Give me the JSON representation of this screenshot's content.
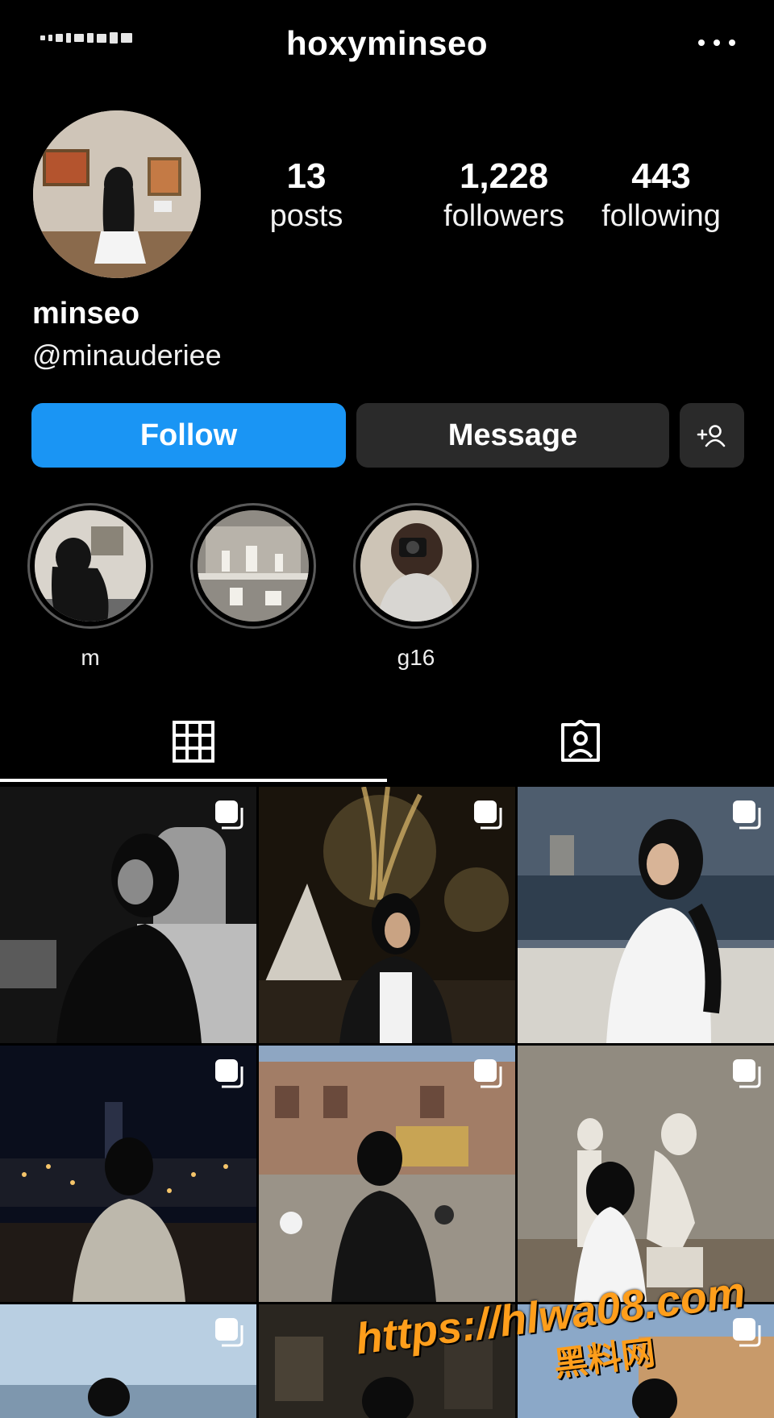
{
  "header": {
    "username": "hoxyminseo",
    "status_icon": "signal-status-icon",
    "more_icon": "more-horizontal-icon"
  },
  "profile": {
    "stats": [
      {
        "count": "13",
        "label": "posts"
      },
      {
        "count": "1,228",
        "label": "followers"
      },
      {
        "count": "443",
        "label": "following"
      }
    ],
    "display_name": "minseo",
    "handle": "@minauderiee"
  },
  "actions": {
    "follow_label": "Follow",
    "message_label": "Message",
    "add_user_icon": "add-person-icon",
    "follow_color": "#1a95f4"
  },
  "highlights": [
    {
      "label": "m"
    },
    {
      "label": ""
    },
    {
      "label": "g16"
    }
  ],
  "tabs": [
    {
      "name": "grid",
      "icon": "grid-icon",
      "active": true
    },
    {
      "name": "tagged",
      "icon": "tagged-person-icon",
      "active": false
    }
  ],
  "posts": [
    {
      "scene": "car-night",
      "multiple": true
    },
    {
      "scene": "christmas-lights",
      "multiple": true
    },
    {
      "scene": "waterfront",
      "multiple": true
    },
    {
      "scene": "city-night",
      "multiple": true
    },
    {
      "scene": "theme-park",
      "multiple": true
    },
    {
      "scene": "statues-museum",
      "multiple": true
    },
    {
      "scene": "sky",
      "multiple": true
    },
    {
      "scene": "dark-interior",
      "multiple": false
    },
    {
      "scene": "mall",
      "multiple": true
    }
  ],
  "watermark": {
    "url": "https://hlwa08.com",
    "cn": "黑料网"
  }
}
